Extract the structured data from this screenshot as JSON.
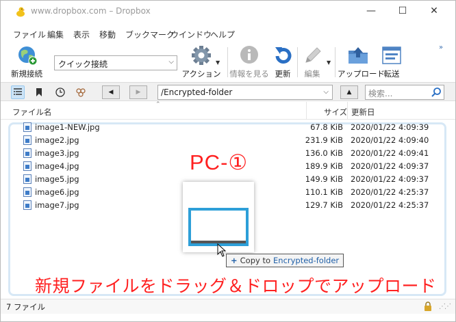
{
  "window": {
    "title": "www.dropbox.com – Dropbox",
    "minimize": "—",
    "maximize": "☐",
    "close": "✕"
  },
  "menu": [
    "ファイル",
    "編集",
    "表示",
    "移動",
    "ブックマーク",
    "ウインドウ",
    "ヘルプ"
  ],
  "toolbar": {
    "new_connection": "新規接続",
    "quick_connect": "クイック接続",
    "action": "アクション",
    "info": "情報を見る",
    "refresh": "更新",
    "edit": "編集",
    "upload": "アップロード",
    "transfer": "転送",
    "overflow": "»"
  },
  "navbar": {
    "path": "/Encrypted-folder",
    "search_placeholder": "検索...",
    "back": "◀",
    "forward": "▶",
    "up": "▲"
  },
  "columns": {
    "name": "ファイル名",
    "size": "サイズ",
    "modified": "更新日"
  },
  "files": [
    {
      "name": "image1-NEW.jpg",
      "size": "67.8 KiB",
      "modified": "2020/01/22 4:09:39"
    },
    {
      "name": "image2.jpg",
      "size": "231.9 KiB",
      "modified": "2020/01/22 4:09:40"
    },
    {
      "name": "image3.jpg",
      "size": "136.0 KiB",
      "modified": "2020/01/22 4:09:41"
    },
    {
      "name": "image4.jpg",
      "size": "189.9 KiB",
      "modified": "2020/01/22 4:09:37"
    },
    {
      "name": "image5.jpg",
      "size": "149.9 KiB",
      "modified": "2020/01/22 4:09:37"
    },
    {
      "name": "image6.jpg",
      "size": "110.1 KiB",
      "modified": "2020/01/22 4:25:37"
    },
    {
      "name": "image7.jpg",
      "size": "129.7 KiB",
      "modified": "2020/01/22 4:25:37"
    }
  ],
  "overlay": {
    "pc_label": "PC-①",
    "drop_plus": "+",
    "drop_tip_prefix": "Copy to",
    "drop_tip_target": "Encrypted-folder",
    "caption": "新規ファイルをドラッグ＆ドロップでアップロード"
  },
  "status": {
    "text": "7 ファイル"
  },
  "colors": {
    "accent": "#3e7cc8",
    "annotation_red": "#ff2020",
    "drop_highlight": "#d7e8f6"
  }
}
